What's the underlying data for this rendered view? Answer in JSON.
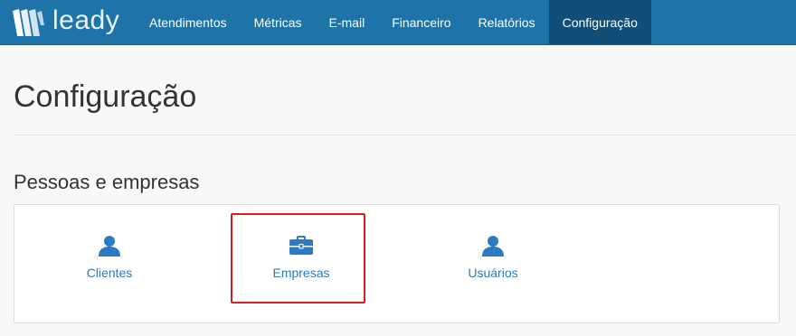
{
  "app": {
    "brand_name": "leady"
  },
  "nav": {
    "items": [
      {
        "label": "Atendimentos",
        "active": false
      },
      {
        "label": "Métricas",
        "active": false
      },
      {
        "label": "E-mail",
        "active": false
      },
      {
        "label": "Financeiro",
        "active": false
      },
      {
        "label": "Relatórios",
        "active": false
      },
      {
        "label": "Configuração",
        "active": true
      }
    ]
  },
  "page": {
    "title": "Configuração"
  },
  "section": {
    "title": "Pessoas e empresas",
    "tiles": [
      {
        "label": "Clientes",
        "icon": "user-icon"
      },
      {
        "label": "Empresas",
        "icon": "briefcase-icon"
      },
      {
        "label": "Usuários",
        "icon": "user-icon"
      }
    ]
  },
  "colors": {
    "navbar": "#1e73a8",
    "nav_active": "#124f78",
    "link": "#2a7bbf",
    "highlight": "#d42020"
  }
}
